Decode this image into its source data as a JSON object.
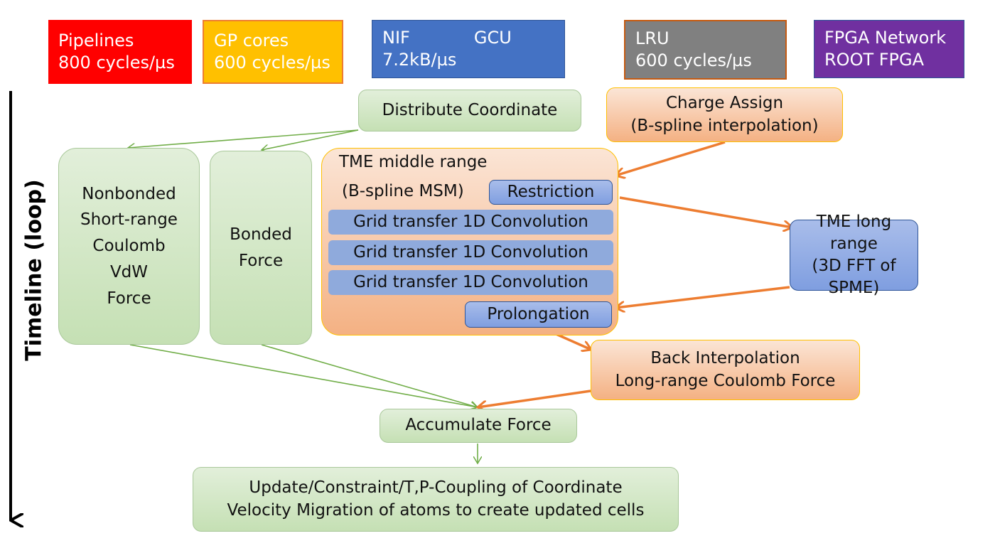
{
  "legend": [
    {
      "line1": "Pipelines",
      "line2": "800 cycles/µs",
      "color": "#ff0000"
    },
    {
      "line1": "GP cores",
      "line2": "600 cycles/µs",
      "color": "#ffc000"
    },
    {
      "line1": "NIF",
      "line1b": "GCU",
      "line2": "7.2kB/µs",
      "color": "#4472c4"
    },
    {
      "line1": "LRU",
      "line2": "600 cycles/µs",
      "color": "#808080"
    },
    {
      "line1": "FPGA Network",
      "line2": "ROOT FPGA",
      "color": "#7030a0"
    }
  ],
  "timeline_label": "Timeline (loop)",
  "nodes": {
    "distribute": "Distribute Coordinate",
    "charge_assign": [
      "Charge Assign",
      "(B-spline interpolation)"
    ],
    "nonbonded": [
      "Nonbonded",
      "Short-range",
      "Coulomb",
      "VdW",
      "Force"
    ],
    "bonded": [
      "Bonded",
      "Force"
    ],
    "tme_middle": [
      "TME middle range",
      "(B-spline MSM)"
    ],
    "restriction": "Restriction",
    "grid_transfer": [
      "Grid transfer 1D Convolution",
      "Grid transfer 1D Convolution",
      "Grid transfer 1D Convolution"
    ],
    "prolongation": "Prolongation",
    "tme_long": [
      "TME long range",
      "(3D FFT of SPME)"
    ],
    "back_interp": [
      "Back Interpolation",
      "Long-range Coulomb Force"
    ],
    "accumulate": "Accumulate Force",
    "update": [
      "Update/Constraint/T,P-Coupling of Coordinate",
      "Velocity Migration of atoms to create updated cells"
    ]
  },
  "colors": {
    "green_arrow": "#70ad47",
    "orange_arrow": "#ed7d31"
  }
}
